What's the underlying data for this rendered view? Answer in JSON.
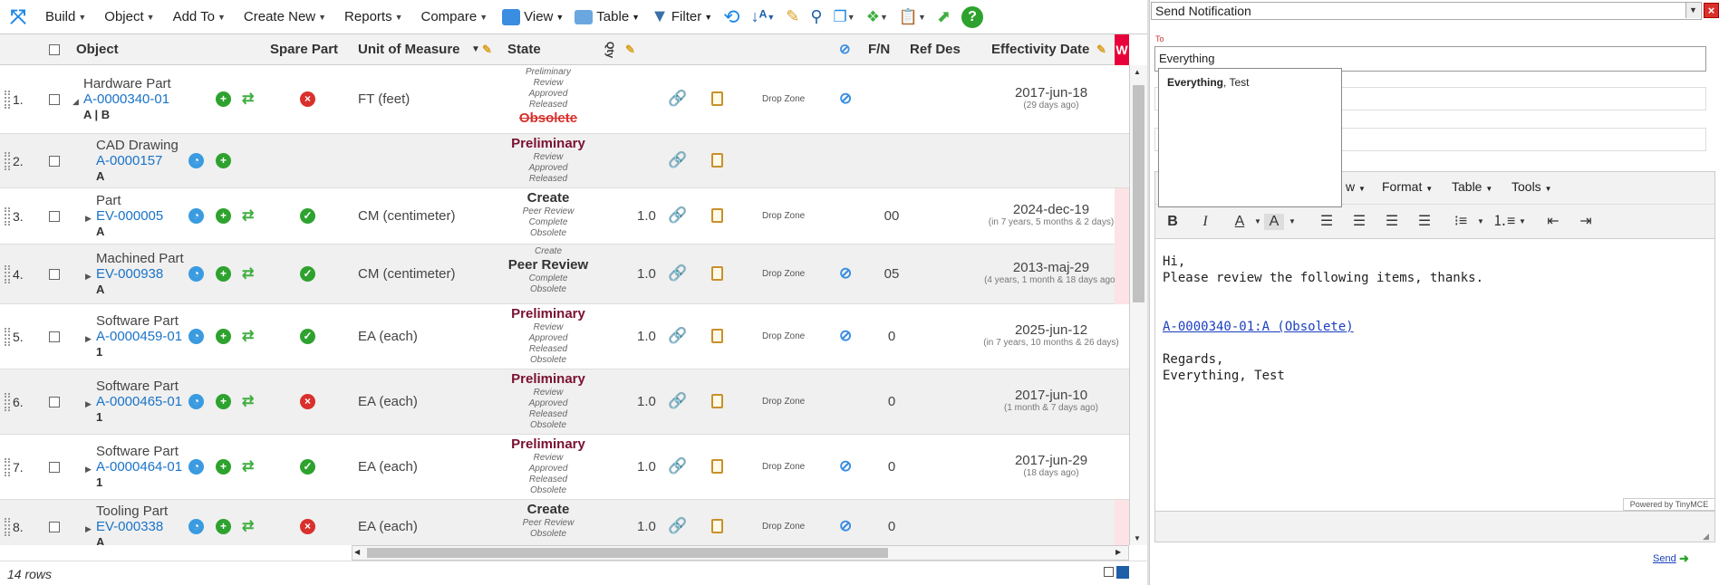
{
  "toolbar": {
    "menus": [
      "Build",
      "Object",
      "Add To",
      "Create New",
      "Reports",
      "Compare"
    ],
    "view_label": "View",
    "table_label": "Table",
    "filter_label": "Filter"
  },
  "grid": {
    "headers": {
      "object": "Object",
      "spare_part": "Spare Part",
      "uom": "Unit of Measure",
      "state": "State",
      "qty": "Qty",
      "fn": "F/N",
      "refdes": "Ref Des",
      "effdate": "Effectivity Date",
      "extra": "W"
    },
    "drop_zone_label": "Drop Zone",
    "rows": [
      {
        "num": "1.",
        "type": "Hardware Part",
        "number": "A-0000340-01",
        "rev": "A | B",
        "spare": "no",
        "uom": "FT (feet)",
        "states_before": [
          "Preliminary",
          "Review",
          "Approved",
          "Released"
        ],
        "current": "Obsolete",
        "states_after": [],
        "qty": "",
        "fn": "",
        "refdes": "",
        "eff_date": "2017-jun-18",
        "eff_sub": "(29 days ago)"
      },
      {
        "num": "2.",
        "type": "CAD Drawing",
        "number": "A-0000157",
        "rev": "A",
        "spare": "",
        "uom": "",
        "states_before": [],
        "current": "Preliminary",
        "states_after": [
          "Review",
          "Approved",
          "Released"
        ],
        "qty": "",
        "fn": "",
        "refdes": "",
        "eff_date": "",
        "eff_sub": ""
      },
      {
        "num": "3.",
        "type": "Part",
        "number": "EV-000005",
        "rev": "A",
        "spare": "yes",
        "uom": "CM (centimeter)",
        "states_before": [],
        "current": "Create",
        "states_after": [
          "Peer Review",
          "Complete",
          "Obsolete"
        ],
        "qty": "1.0",
        "fn": "00",
        "refdes": "",
        "eff_date": "2024-dec-19",
        "eff_sub": "(in 7 years, 5 months & 2 days)"
      },
      {
        "num": "4.",
        "type": "Machined Part",
        "number": "EV-000938",
        "rev": "A",
        "spare": "yes",
        "uom": "CM (centimeter)",
        "states_before": [
          "Create"
        ],
        "current": "Peer Review",
        "states_after": [
          "Complete",
          "Obsolete"
        ],
        "qty": "1.0",
        "fn": "05",
        "refdes": "",
        "eff_date": "2013-maj-29",
        "eff_sub": "(4 years, 1 month & 18 days ago)"
      },
      {
        "num": "5.",
        "type": "Software Part",
        "number": "A-0000459-01",
        "rev": "1",
        "spare": "yes",
        "uom": "EA (each)",
        "states_before": [],
        "current": "Preliminary",
        "states_after": [
          "Review",
          "Approved",
          "Released",
          "Obsolete"
        ],
        "qty": "1.0",
        "fn": "0",
        "refdes": "",
        "eff_date": "2025-jun-12",
        "eff_sub": "(in 7 years, 10 months & 26 days)"
      },
      {
        "num": "6.",
        "type": "Software Part",
        "number": "A-0000465-01",
        "rev": "1",
        "spare": "no",
        "uom": "EA (each)",
        "states_before": [],
        "current": "Preliminary",
        "states_after": [
          "Review",
          "Approved",
          "Released",
          "Obsolete"
        ],
        "qty": "1.0",
        "fn": "0",
        "refdes": "",
        "eff_date": "2017-jun-10",
        "eff_sub": "(1 month & 7 days ago)"
      },
      {
        "num": "7.",
        "type": "Software Part",
        "number": "A-0000464-01",
        "rev": "1",
        "spare": "yes",
        "uom": "EA (each)",
        "states_before": [],
        "current": "Preliminary",
        "states_after": [
          "Review",
          "Approved",
          "Released",
          "Obsolete"
        ],
        "qty": "1.0",
        "fn": "0",
        "refdes": "",
        "eff_date": "2017-jun-29",
        "eff_sub": "(18 days ago)"
      },
      {
        "num": "8.",
        "type": "Tooling Part",
        "number": "EV-000338",
        "rev": "A",
        "spare": "no",
        "uom": "EA (each)",
        "states_before": [],
        "current": "Create",
        "states_after": [
          "Peer Review",
          "Obsolete"
        ],
        "qty": "1.0",
        "fn": "0",
        "refdes": "",
        "eff_date": "",
        "eff_sub": ""
      }
    ]
  },
  "footer": {
    "row_count": "14 rows"
  },
  "notification": {
    "title": "Send Notification",
    "to_label": "To",
    "to_value": "Everything",
    "autocomplete_bold": "Everything",
    "autocomplete_rest": ", Test",
    "editor_menus": [
      "w",
      "Format",
      "Table",
      "Tools"
    ],
    "body_greeting": "Hi,",
    "body_line": "Please review the following items, thanks.",
    "body_link": "A-0000340-01:A (Obsolete)",
    "body_regards": "Regards,",
    "body_signature": "Everything, Test",
    "powered_by": "Powered by TinyMCE",
    "send_label": "Send"
  },
  "colors": {
    "accent": "#1a73c8",
    "obsolete": "#d9302c",
    "preliminary": "#7a1030",
    "spare_yes": "#2ea22e",
    "spare_no": "#d9302c"
  }
}
